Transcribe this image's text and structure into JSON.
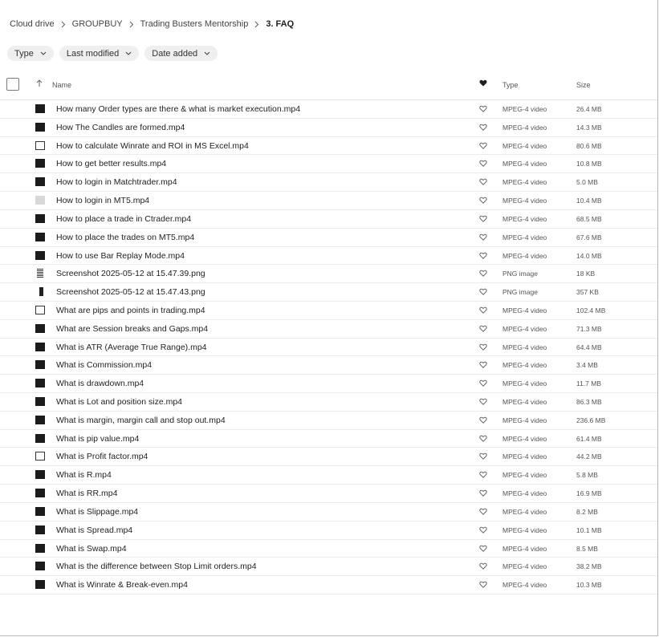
{
  "breadcrumb": {
    "items": [
      "Cloud drive",
      "GROUPBUY",
      "Trading Busters Mentorship"
    ],
    "current": "3. FAQ"
  },
  "filters": [
    "Type",
    "Last modified",
    "Date added"
  ],
  "columns": {
    "name": "Name",
    "type": "Type",
    "size": "Size"
  },
  "files": [
    {
      "name": "How many Order types are there & what is market execution.mp4",
      "type": "MPEG-4 video",
      "size": "26.4 MB",
      "thumb": "dark"
    },
    {
      "name": "How The Candles are formed.mp4",
      "type": "MPEG-4 video",
      "size": "14.3 MB",
      "thumb": "dark"
    },
    {
      "name": "How to calculate Winrate and ROI in MS Excel.mp4",
      "type": "MPEG-4 video",
      "size": "80.6 MB",
      "thumb": "white"
    },
    {
      "name": "How to get better results.mp4",
      "type": "MPEG-4 video",
      "size": "10.8 MB",
      "thumb": "dark"
    },
    {
      "name": "How to login in Matchtrader.mp4",
      "type": "MPEG-4 video",
      "size": "5.0 MB",
      "thumb": "dark"
    },
    {
      "name": "How to login in MT5.mp4",
      "type": "MPEG-4 video",
      "size": "10.4 MB",
      "thumb": "light"
    },
    {
      "name": "How to place a trade in Ctrader.mp4",
      "type": "MPEG-4 video",
      "size": "68.5 MB",
      "thumb": "dark"
    },
    {
      "name": "How to place the trades on MT5.mp4",
      "type": "MPEG-4 video",
      "size": "67.6 MB",
      "thumb": "dark"
    },
    {
      "name": "How to use Bar Replay Mode.mp4",
      "type": "MPEG-4 video",
      "size": "14.0 MB",
      "thumb": "dark"
    },
    {
      "name": "Screenshot 2025-05-12 at 15.47.39.png",
      "type": "PNG image",
      "size": "18 KB",
      "thumb": "png1"
    },
    {
      "name": "Screenshot 2025-05-12 at 15.47.43.png",
      "type": "PNG image",
      "size": "357 KB",
      "thumb": "png2"
    },
    {
      "name": "What are pips and points in trading.mp4",
      "type": "MPEG-4 video",
      "size": "102.4 MB",
      "thumb": "white"
    },
    {
      "name": "What are Session breaks and Gaps.mp4",
      "type": "MPEG-4 video",
      "size": "71.3 MB",
      "thumb": "dark"
    },
    {
      "name": "What is ATR (Average True Range).mp4",
      "type": "MPEG-4 video",
      "size": "64.4 MB",
      "thumb": "dark"
    },
    {
      "name": "What is Commission.mp4",
      "type": "MPEG-4 video",
      "size": "3.4 MB",
      "thumb": "dark"
    },
    {
      "name": "What is drawdown.mp4",
      "type": "MPEG-4 video",
      "size": "11.7 MB",
      "thumb": "dark"
    },
    {
      "name": "What is Lot and position size.mp4",
      "type": "MPEG-4 video",
      "size": "86.3 MB",
      "thumb": "dark"
    },
    {
      "name": "What is margin, margin call and stop out.mp4",
      "type": "MPEG-4 video",
      "size": "236.6 MB",
      "thumb": "dark"
    },
    {
      "name": "What is pip value.mp4",
      "type": "MPEG-4 video",
      "size": "61.4 MB",
      "thumb": "dark"
    },
    {
      "name": "What is Profit factor.mp4",
      "type": "MPEG-4 video",
      "size": "44.2 MB",
      "thumb": "white"
    },
    {
      "name": "What is R.mp4",
      "type": "MPEG-4 video",
      "size": "5.8 MB",
      "thumb": "dark"
    },
    {
      "name": "What is RR.mp4",
      "type": "MPEG-4 video",
      "size": "16.9 MB",
      "thumb": "dark"
    },
    {
      "name": "What is Slippage.mp4",
      "type": "MPEG-4 video",
      "size": "8.2 MB",
      "thumb": "dark"
    },
    {
      "name": "What is Spread.mp4",
      "type": "MPEG-4 video",
      "size": "10.1 MB",
      "thumb": "dark"
    },
    {
      "name": "What is Swap.mp4",
      "type": "MPEG-4 video",
      "size": "8.5 MB",
      "thumb": "dark"
    },
    {
      "name": "What is the difference between Stop Limit orders.mp4",
      "type": "MPEG-4 video",
      "size": "38.2 MB",
      "thumb": "dark"
    },
    {
      "name": "What is Winrate & Break-even.mp4",
      "type": "MPEG-4 video",
      "size": "10.3 MB",
      "thumb": "dark"
    }
  ]
}
